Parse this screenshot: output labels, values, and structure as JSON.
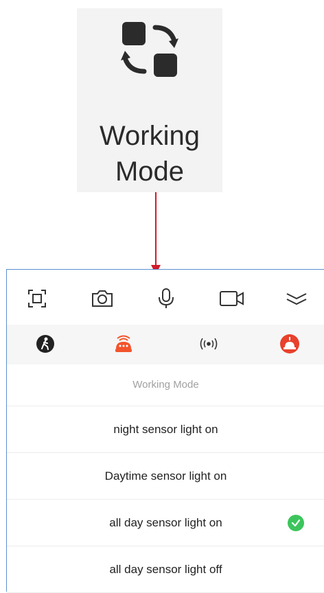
{
  "callout": {
    "title_line1": "Working",
    "title_line2": "Mode",
    "icon": "working-mode-icon"
  },
  "toolbar": {
    "icons": [
      "screenshot-icon",
      "camera-icon",
      "microphone-icon",
      "video-record-icon",
      "collapse-icon"
    ]
  },
  "status_row": {
    "icons": [
      "pedestrian-icon",
      "alarm-light-icon",
      "wireless-signal-icon",
      "siren-icon"
    ]
  },
  "working_mode_sheet": {
    "title": "Working Mode",
    "options": [
      {
        "label": "night sensor light on",
        "selected": false
      },
      {
        "label": "Daytime sensor light on",
        "selected": false
      },
      {
        "label": "all day sensor light on",
        "selected": true
      },
      {
        "label": "all day sensor light off",
        "selected": false
      }
    ]
  },
  "colors": {
    "arrow": "#d11a2a",
    "selected_check": "#3cc55c",
    "alarm_orange": "#f2542d",
    "siren_red": "#e8412c"
  }
}
